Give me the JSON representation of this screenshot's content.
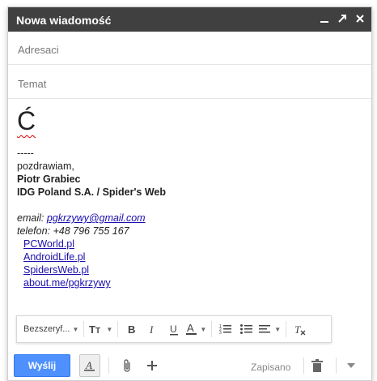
{
  "window": {
    "title": "Nowa wiadomość"
  },
  "fields": {
    "to_placeholder": "Adresaci",
    "subject_placeholder": "Temat"
  },
  "body": {
    "big_char": "Ć",
    "separator": "-----",
    "greeting": "pozdrawiam,",
    "name": "Piotr Grabiec",
    "company": "IDG Poland S.A. / Spider's Web",
    "email_label": "email: ",
    "email_value": "pgkrzywy@gmail.com",
    "phone_line": "telefon: +48 796 755 167",
    "links": [
      "PCWorld.pl",
      "AndroidLife.pl",
      "SpidersWeb.pl",
      "about.me/pgkrzywy"
    ]
  },
  "format_bar": {
    "font_name": "Bezszeryf..."
  },
  "bottom": {
    "send_label": "Wyślij",
    "saved_label": "Zapisano"
  },
  "colors": {
    "titlebar": "#404040",
    "send": "#4d90fe",
    "link": "#1a0dab"
  }
}
